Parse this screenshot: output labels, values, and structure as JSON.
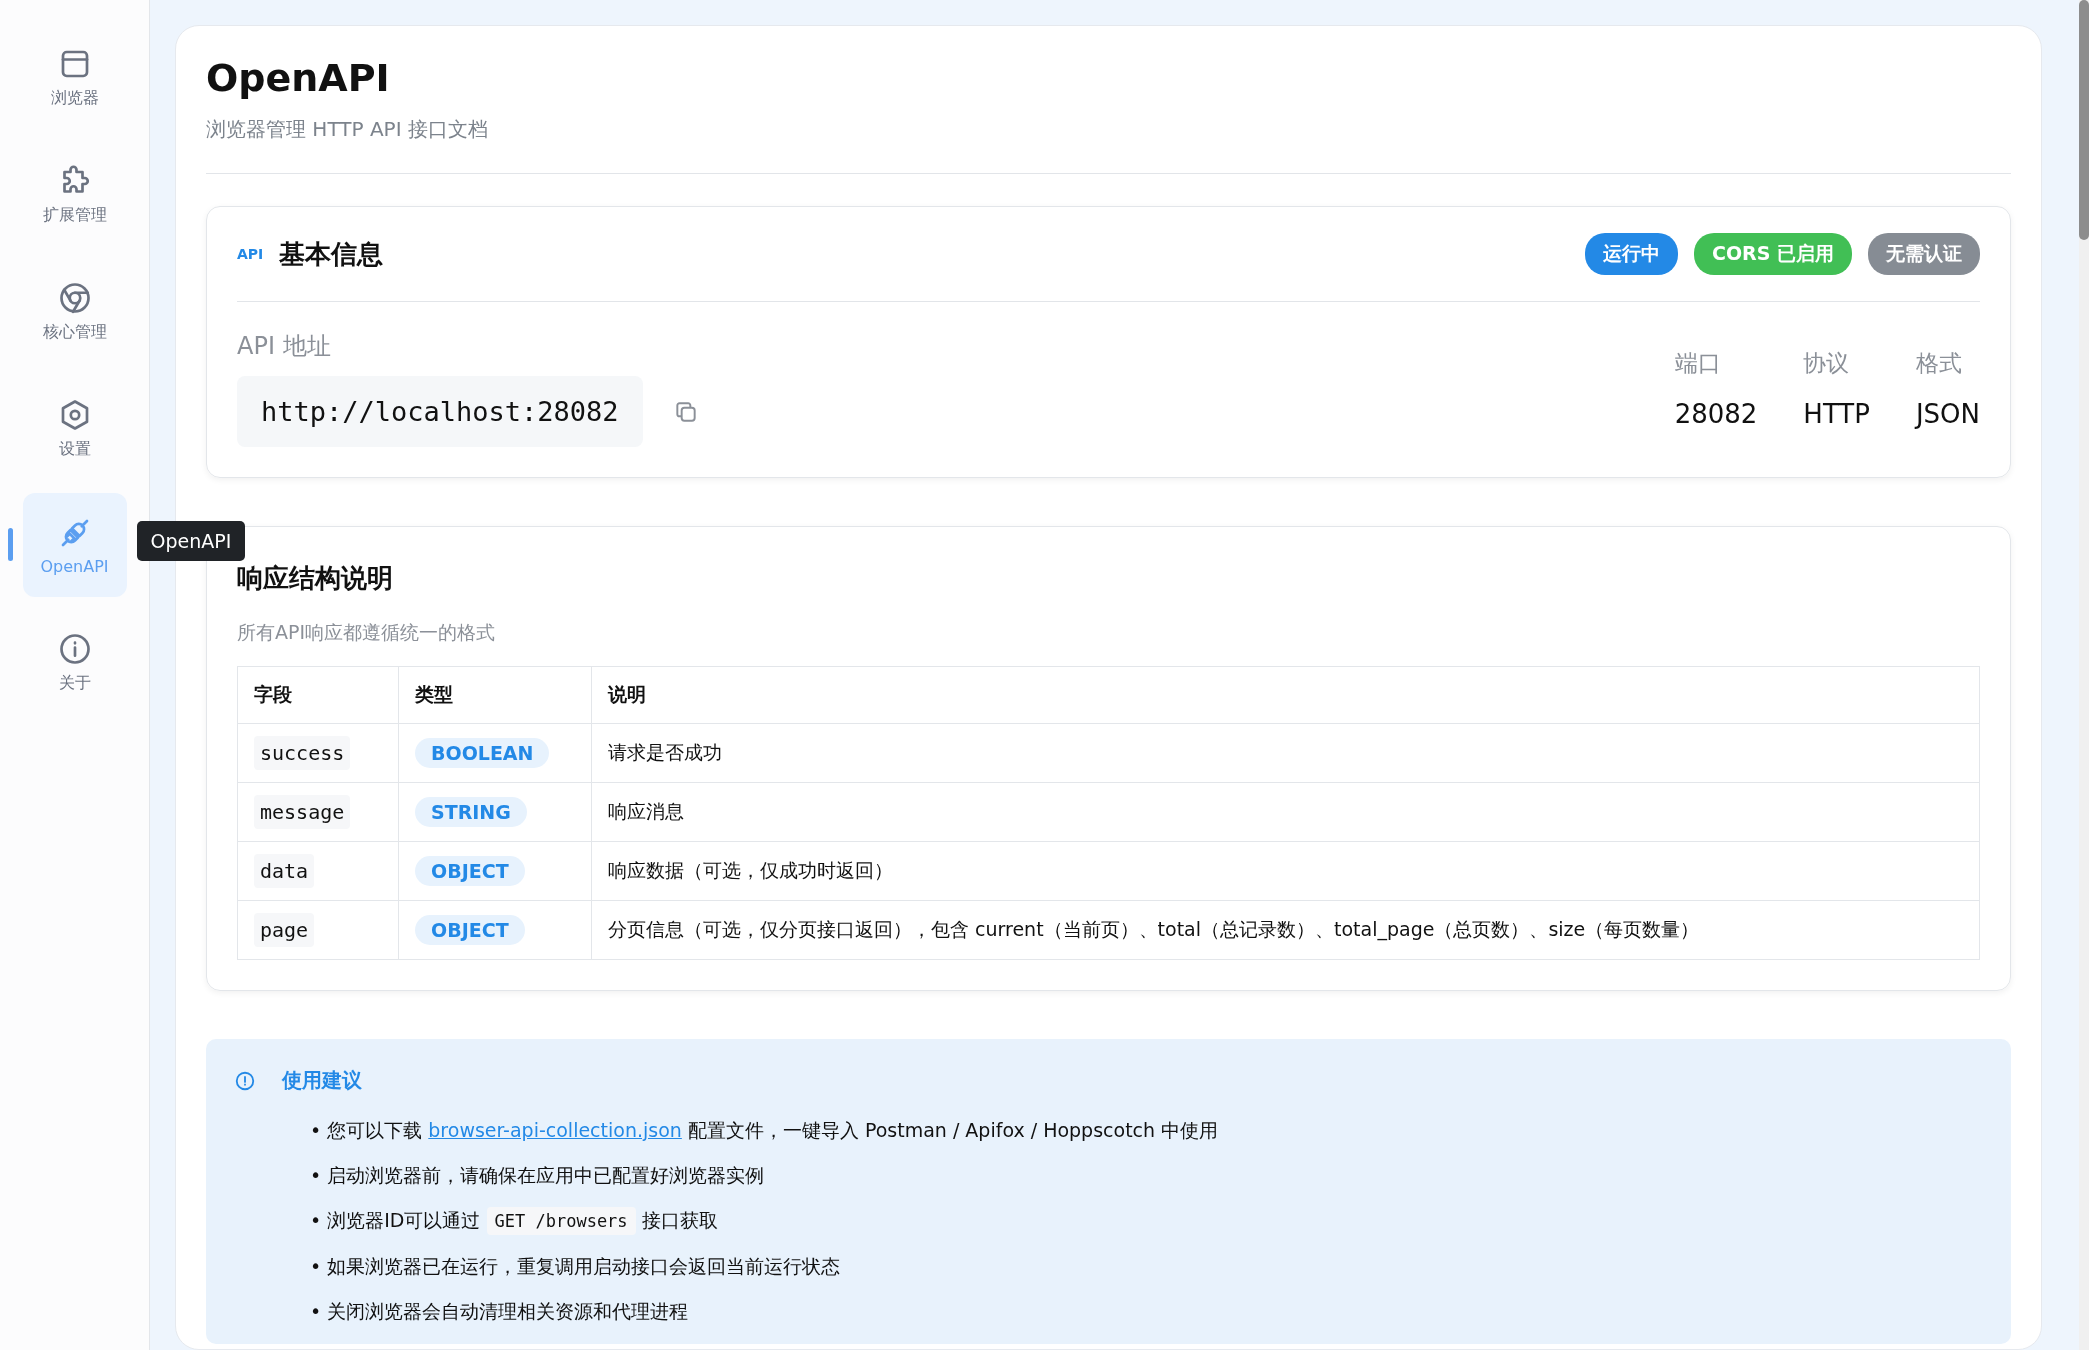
{
  "sidebar": {
    "items": [
      {
        "label": "浏览器",
        "kind": "window",
        "selected": false
      },
      {
        "label": "扩展管理",
        "kind": "puzzle",
        "selected": false
      },
      {
        "label": "核心管理",
        "kind": "aperture",
        "selected": false
      },
      {
        "label": "设置",
        "kind": "hexagon",
        "selected": false
      },
      {
        "label": "OpenAPI",
        "kind": "plug",
        "selected": true
      },
      {
        "label": "关于",
        "kind": "info",
        "selected": false
      }
    ],
    "tooltip": "OpenAPI"
  },
  "page": {
    "title": "OpenAPI",
    "subtitle": "浏览器管理 HTTP API 接口文档"
  },
  "basic_info": {
    "icon_text": "API",
    "title": "基本信息",
    "badges": [
      {
        "text": "运行中",
        "color": "#2389e6"
      },
      {
        "text": "CORS 已启用",
        "color": "#41bf55"
      },
      {
        "text": "无需认证",
        "color": "#868c94"
      }
    ],
    "address_label": "API 地址",
    "address": "http://localhost:28082",
    "stats": [
      {
        "label": "端口",
        "value": "28082"
      },
      {
        "label": "协议",
        "value": "HTTP"
      },
      {
        "label": "格式",
        "value": "JSON"
      }
    ]
  },
  "response": {
    "title": "响应结构说明",
    "subtitle": "所有API响应都遵循统一的格式",
    "table": {
      "columns": [
        "字段",
        "类型",
        "说明"
      ],
      "rows": [
        {
          "field": "success",
          "type": "BOOLEAN",
          "description": "请求是否成功"
        },
        {
          "field": "message",
          "type": "STRING",
          "description": "响应消息"
        },
        {
          "field": "data",
          "type": "OBJECT",
          "description": "响应数据（可选，仅成功时返回）"
        },
        {
          "field": "page",
          "type": "OBJECT",
          "description": "分页信息（可选，仅分页接口返回），包含 current（当前页）、total（总记录数）、total_page（总页数）、size（每页数量）"
        }
      ]
    }
  },
  "tips": {
    "title": "使用建议",
    "items": [
      [
        {
          "kind": "text",
          "text": "• 您可以下载 "
        },
        {
          "kind": "link",
          "text": "browser-api-collection.json"
        },
        {
          "kind": "text",
          "text": " 配置文件，一键导入 Postman / Apifox / Hoppscotch 中使用"
        }
      ],
      [
        {
          "kind": "text",
          "text": "• 启动浏览器前，请确保在应用中已配置好浏览器实例"
        }
      ],
      [
        {
          "kind": "text",
          "text": "• 浏览器ID可以通过 "
        },
        {
          "kind": "code",
          "text": "GET /browsers"
        },
        {
          "kind": "text",
          "text": " 接口获取"
        }
      ],
      [
        {
          "kind": "text",
          "text": "• 如果浏览器已在运行，重复调用启动接口会返回当前运行状态"
        }
      ],
      [
        {
          "kind": "text",
          "text": "• 关闭浏览器会自动清理相关资源和代理进程"
        }
      ]
    ]
  }
}
